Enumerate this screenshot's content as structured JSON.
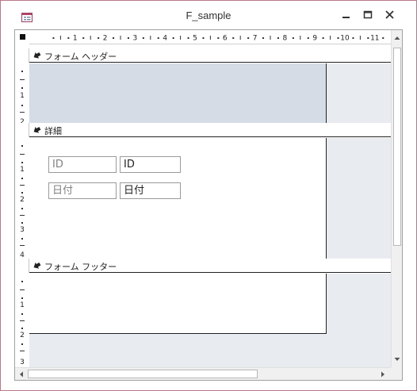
{
  "window": {
    "title": "F_sample",
    "icon": "access-form-icon",
    "controls": [
      "minimize-icon",
      "maximize-icon",
      "close-icon"
    ],
    "border_color": "#b9798a"
  },
  "ruler": {
    "labels": [
      "1",
      "2",
      "3",
      "4",
      "5",
      "6",
      "7",
      "8",
      "9",
      "10",
      "11",
      "1"
    ]
  },
  "sections": {
    "header": {
      "label": "フォーム ヘッダー",
      "vruler": [
        "1",
        "2"
      ],
      "fill": "#d5dce6"
    },
    "detail": {
      "label": "詳細",
      "vruler": [
        "1",
        "2",
        "3",
        "4"
      ],
      "controls": [
        {
          "label": "ID",
          "textbox": "ID"
        },
        {
          "label": "日付",
          "textbox": "日付"
        }
      ]
    },
    "footer": {
      "label": "フォーム フッター",
      "vruler": [
        "1",
        "2",
        "3"
      ]
    }
  },
  "colors": {
    "design_area_gray": "#e8ebef",
    "header_fill": "#d5dce6"
  }
}
